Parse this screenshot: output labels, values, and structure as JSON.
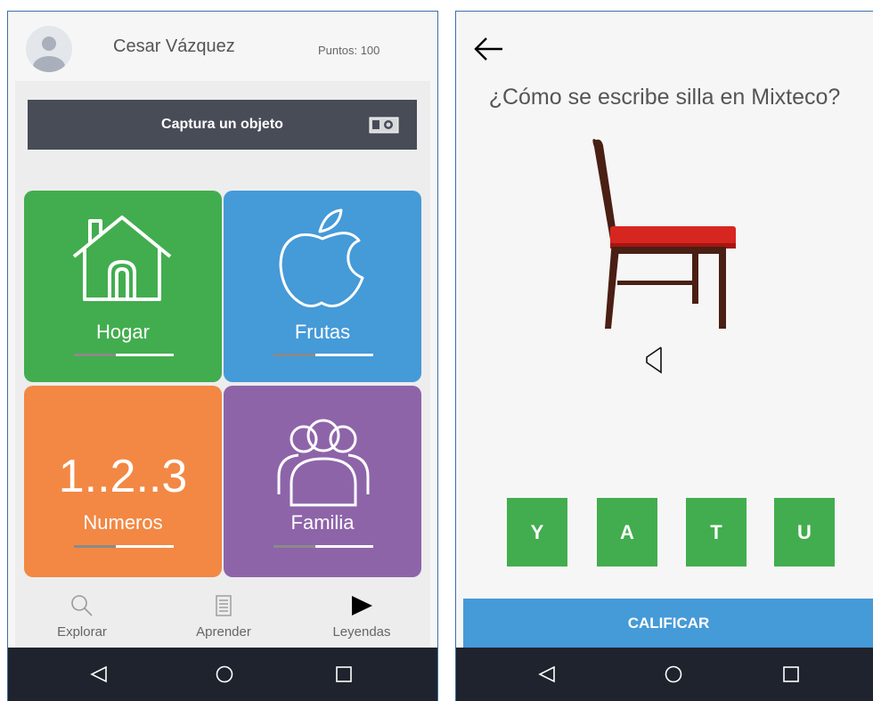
{
  "home": {
    "user_name": "Cesar Vázquez",
    "points": "Puntos: 100",
    "capture_label": "Captura un objeto",
    "categories": [
      {
        "label": "Hogar",
        "progress": 0.42,
        "color": "#42ad4e"
      },
      {
        "label": "Frutas",
        "progress": 0.42,
        "color": "#459ad8"
      },
      {
        "label": "Numeros",
        "progress": 0.42,
        "color": "#f28844",
        "display": "1..2..3"
      },
      {
        "label": "Familia",
        "progress": 0.42,
        "color": "#8e64a9"
      }
    ],
    "nav": [
      {
        "label": "Explorar",
        "icon": "search-icon"
      },
      {
        "label": "Aprender",
        "icon": "document-icon"
      },
      {
        "label": "Leyendas",
        "icon": "play-icon"
      }
    ]
  },
  "quiz": {
    "question": "¿Cómo se escribe silla en Mixteco?",
    "letters": [
      "Y",
      "A",
      "T",
      "U"
    ],
    "submit_label": "CALIFICAR",
    "letter_color": "#42ad4e",
    "submit_color": "#459ad8"
  }
}
